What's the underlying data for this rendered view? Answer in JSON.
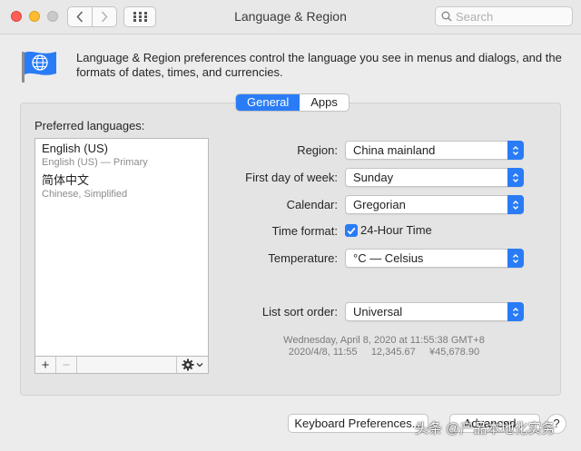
{
  "window": {
    "title": "Language & Region"
  },
  "nav": {
    "back_icon": "chevron-left-icon",
    "forward_icon": "chevron-right-icon",
    "grid_icon": "grid-icon"
  },
  "search": {
    "placeholder": "Search",
    "value": ""
  },
  "header": {
    "icon": "globe-flag-icon",
    "description": "Language & Region preferences control the language you see in menus and dialogs, and the formats of dates, times, and currencies."
  },
  "tabs": [
    {
      "label": "General",
      "active": true
    },
    {
      "label": "Apps",
      "active": false
    }
  ],
  "preferred_languages": {
    "label": "Preferred languages:",
    "items": [
      {
        "name": "English (US)",
        "sub": "English (US) — Primary"
      },
      {
        "name": "简体中文",
        "sub": "Chinese, Simplified"
      }
    ],
    "add_label": "+",
    "remove_label": "−"
  },
  "settings": {
    "region": {
      "label": "Region:",
      "value": "China mainland"
    },
    "first_day": {
      "label": "First day of week:",
      "value": "Sunday"
    },
    "calendar": {
      "label": "Calendar:",
      "value": "Gregorian"
    },
    "time_format": {
      "label": "Time format:",
      "value": "24-Hour Time",
      "checked": true
    },
    "temperature": {
      "label": "Temperature:",
      "value": "°C — Celsius"
    },
    "sort_order": {
      "label": "List sort order:",
      "value": "Universal"
    }
  },
  "sample": {
    "line1": "Wednesday, April 8, 2020 at 11:55:38 GMT+8",
    "line2": "2020/4/8, 11:55     12,345.67     ¥45,678.90"
  },
  "buttons": {
    "keyboard": "Keyboard Preferences...",
    "advanced": "Advanced...",
    "help": "?"
  },
  "watermark": "头条 @产品本地化实务",
  "colors": {
    "accent": "#2a7cf6",
    "close": "#fe5f57",
    "minimize": "#febc2e"
  }
}
